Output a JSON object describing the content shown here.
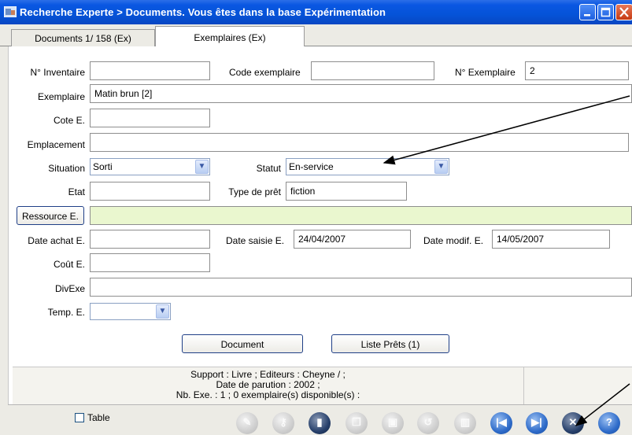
{
  "window": {
    "title": "Recherche Experte > Documents.  Vous êtes dans la base Expérimentation"
  },
  "tabs": [
    {
      "label": "Documents   1/ 158 (Ex)"
    },
    {
      "label": "Exemplaires  (Ex)"
    }
  ],
  "form": {
    "inventaire": {
      "label": "N° Inventaire",
      "value": ""
    },
    "code_exemplaire": {
      "label": "Code exemplaire",
      "value": ""
    },
    "num_exemplaire": {
      "label": "N° Exemplaire",
      "value": "2"
    },
    "exemplaire": {
      "label": "Exemplaire",
      "value": "Matin brun [2]"
    },
    "cote": {
      "label": "Cote E.",
      "value": ""
    },
    "emplacement": {
      "label": "Emplacement",
      "value": ""
    },
    "situation": {
      "label": "Situation",
      "value": "Sorti"
    },
    "statut": {
      "label": "Statut",
      "value": "En-service"
    },
    "etat": {
      "label": "Etat",
      "value": ""
    },
    "type_pret": {
      "label": "Type de prêt",
      "value": "fiction"
    },
    "ressource_button": "Ressource E.",
    "ressource_value": "",
    "date_achat": {
      "label": "Date achat E.",
      "value": ""
    },
    "date_saisie": {
      "label": "Date saisie E.",
      "value": "24/04/2007"
    },
    "date_modif": {
      "label": "Date modif. E.",
      "value": "14/05/2007"
    },
    "cout": {
      "label": "Coût E.",
      "value": ""
    },
    "divexe": {
      "label": "DivExe",
      "value": ""
    },
    "temp": {
      "label": "Temp. E.",
      "value": ""
    }
  },
  "buttons": {
    "document": "Document",
    "liste_prets": "Liste Prêts  (1)"
  },
  "info": {
    "line1": "Support : Livre ;  Editeurs  : Cheyne / ;",
    "line2": "Date de parution  : 2002 ;",
    "line3": "Nb. Exe. : 1 ; 0 exemplaire(s) disponible(s)  :"
  },
  "bottom": {
    "table_label": "Table"
  },
  "toolbar": [
    {
      "icon": "edit-icon",
      "state": "disabled"
    },
    {
      "icon": "key-icon",
      "state": "disabled"
    },
    {
      "icon": "book-icon",
      "state": "active"
    },
    {
      "icon": "copy-icon",
      "state": "disabled"
    },
    {
      "icon": "save-icon",
      "state": "disabled"
    },
    {
      "icon": "undo-icon",
      "state": "disabled"
    },
    {
      "icon": "trash-icon",
      "state": "disabled"
    },
    {
      "icon": "first-record-icon",
      "state": "active"
    },
    {
      "icon": "last-record-icon",
      "state": "active"
    },
    {
      "icon": "close-icon",
      "state": "active"
    },
    {
      "icon": "help-icon",
      "state": "active"
    }
  ]
}
